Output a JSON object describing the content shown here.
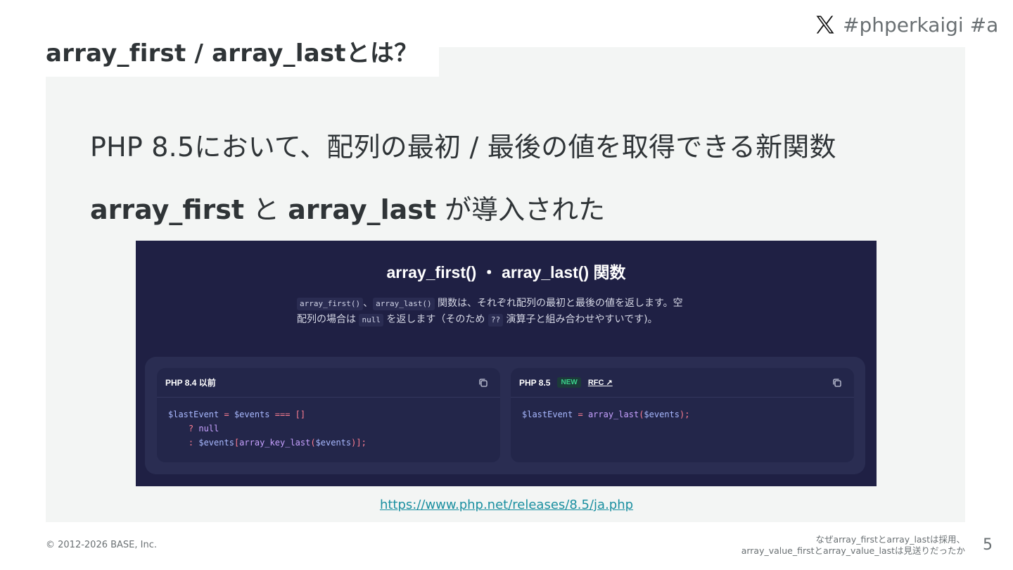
{
  "header": {
    "hashtag": "#phperkaigi #a",
    "x_logo": "x-logo-icon"
  },
  "slide": {
    "title": "array_first / array_lastとは？",
    "lead_line1": "PHP 8.5において、配列の最初 / 最後の値を取得できる新関数",
    "lead_line2_fn1": "array_first",
    "lead_line2_mid": " と ",
    "lead_line2_fn2": "array_last",
    "lead_line2_tail": " が導入された"
  },
  "screenshot": {
    "title": "array_first() ・ array_last() 関数",
    "desc": {
      "chip1": "array_first()",
      "sep": "、",
      "chip2": "array_last()",
      "text1": " 関数は、それぞれ配列の最初と最後の値を返します。空",
      "text2": "配列の場合は ",
      "chip3": "null",
      "text3": " を返します（そのため ",
      "chip4": "??",
      "text4": " 演算子と組み合わせやすいです)。"
    },
    "before": {
      "label": "PHP 8.4 以前",
      "copy_icon": "copy-icon",
      "code": {
        "l1_var": "$lastEvent",
        "l1_eq": " = ",
        "l1_var2": "$events",
        "l1_op": " === ",
        "l1_arr": "[]",
        "l2_q": "? ",
        "l2_null": "null",
        "l3_colon": ": ",
        "l3_var": "$events",
        "l3_b1": "[",
        "l3_fn": "array_key_last",
        "l3_p1": "(",
        "l3_arg": "$events",
        "l3_end": ")];"
      }
    },
    "after": {
      "label": "PHP 8.5",
      "badge": "NEW",
      "rfc": "RFC ↗",
      "copy_icon": "copy-icon",
      "code": {
        "var": "$lastEvent",
        "eq": " = ",
        "fn": "array_last",
        "p1": "(",
        "arg": "$events",
        "end": ");"
      }
    }
  },
  "source_link": "https://www.php.net/releases/8.5/ja.php",
  "footer": {
    "copyright": "© 2012-2026 BASE, Inc.",
    "talk_title_line1": "なぜarray_firstとarray_lastは採用、",
    "talk_title_line2": "array_value_firstとarray_value_lastは見送りだったか",
    "page_number": "5"
  },
  "colors": {
    "panel": "#f3f5f4",
    "text": "#2f3437",
    "screenshot_bg": "#1f2044",
    "link": "#1a8fa0"
  }
}
